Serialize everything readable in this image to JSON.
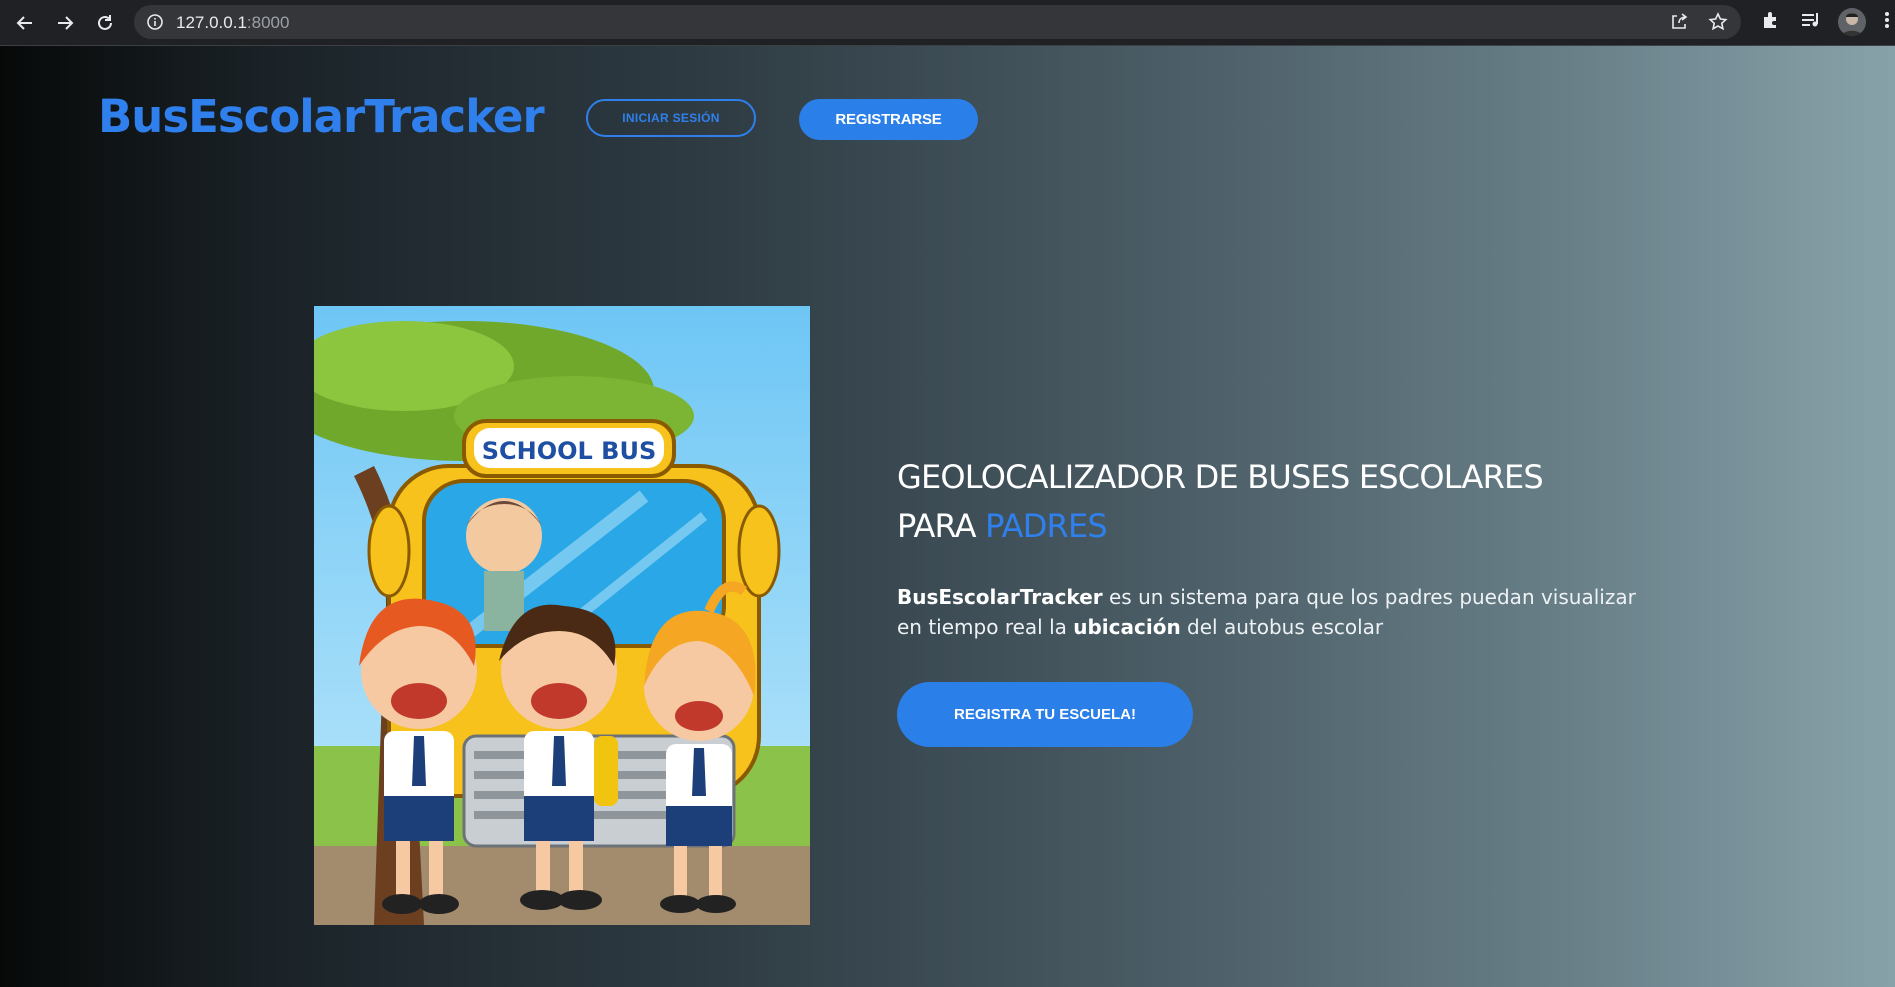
{
  "browser": {
    "url_host": "127.0.0.1",
    "url_port": ":8000"
  },
  "header": {
    "brand": "BusEscolarTracker",
    "login_label": "INICIAR SESIÓN",
    "register_label": "REGISTRARSE"
  },
  "hero": {
    "image_sign": "SCHOOL BUS",
    "headline_line1": "GEOLOCALIZADOR DE BUSES ESCOLARES",
    "headline_line2_prefix": "PARA ",
    "headline_accent": "PADRES",
    "desc_brand": "BusEscolarTracker",
    "desc_part1": " es un sistema para que los padres puedan visualizar en tiempo real la ",
    "desc_bold": "ubicación",
    "desc_part2": " del autobus escolar",
    "cta_label": "REGISTRA TU ESCUELA!"
  },
  "colors": {
    "accent": "#2f80ed",
    "button": "#2b7fe8"
  }
}
